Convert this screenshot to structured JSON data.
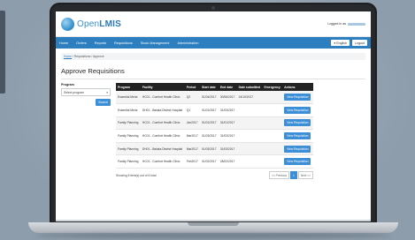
{
  "app": {
    "logo_light": "Open",
    "logo_bold": "LMIS",
    "logged_in_label": "Logged in as"
  },
  "nav": {
    "items": [
      "Home",
      "Orders",
      "Reports",
      "Requisitions",
      "Stock Management",
      "Administration"
    ],
    "language_label": "▾ English",
    "logout_label": "Logout"
  },
  "breadcrumb": {
    "home": "Home",
    "separator": "/",
    "section": "Requisitions",
    "current": "Approve"
  },
  "page": {
    "title": "Approve Requisitions"
  },
  "filters": {
    "program_label": "Program",
    "program_placeholder": "Select program",
    "search_label": "Search"
  },
  "table": {
    "headers": [
      "Program",
      "Facility",
      "Period",
      "Start date",
      "End date",
      "Date submitted",
      "Emergency",
      "Actions"
    ],
    "rows": [
      {
        "program": "Essential Meds",
        "facility": "HC01 - Comfort Health Clinic",
        "period": "Q2",
        "start": "01/04/2017",
        "end": "30/06/2017",
        "submitted": "24/10/2017",
        "emergency": "",
        "action": "View Requisition"
      },
      {
        "program": "Essential Meds",
        "facility": "DH01 - Balaka District Hospital",
        "period": "Q1",
        "start": "01/01/2017",
        "end": "31/03/2017",
        "submitted": "",
        "emergency": "",
        "action": "View Requisition"
      },
      {
        "program": "Family Planning",
        "facility": "HC01 - Comfort Health Clinic",
        "period": "Jan2017",
        "start": "01/01/2017",
        "end": "31/01/2017",
        "submitted": "",
        "emergency": "",
        "action": "View Requisition"
      },
      {
        "program": "Family Planning",
        "facility": "HC01 - Comfort Health Clinic",
        "period": "Mar2017",
        "start": "01/03/2017",
        "end": "31/03/2017",
        "submitted": "",
        "emergency": "",
        "action": "View Requisition"
      },
      {
        "program": "Family Planning",
        "facility": "DH01 - Balaka District Hospital",
        "period": "Mar2017",
        "start": "01/03/2017",
        "end": "31/03/2017",
        "submitted": "",
        "emergency": "",
        "action": "View Requisition"
      },
      {
        "program": "Family Planning",
        "facility": "HC01 - Comfort Health Clinic",
        "period": "Feb2017",
        "start": "01/02/2017",
        "end": "28/02/2017",
        "submitted": "",
        "emergency": "",
        "action": "View Requisition"
      }
    ],
    "showing_text": "Showing 6 item(s) out of 6 total"
  },
  "pagination": {
    "previous": "<< Previous",
    "current_page": "1",
    "next": "Next >>"
  },
  "colors": {
    "nav_blue": "#2d7fbf",
    "button_blue": "#3c8fd6",
    "table_header": "#222222"
  }
}
